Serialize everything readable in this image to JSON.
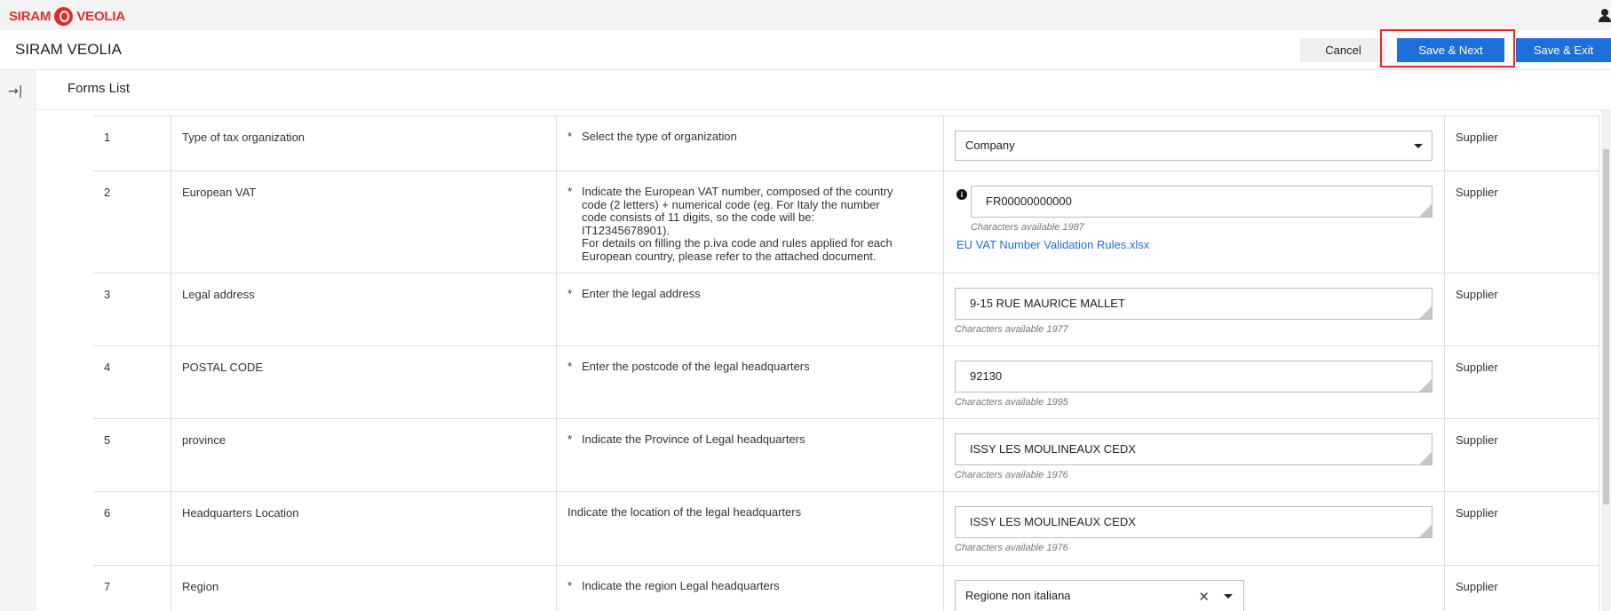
{
  "brand": {
    "left": "SIRAM",
    "right": "VEOLIA"
  },
  "header": {
    "title": "SIRAM VEOLIA",
    "cancel_label": "Cancel",
    "save_next_label": "Save & Next",
    "save_exit_label": "Save & Exit"
  },
  "subheader": {
    "title": "Forms List"
  },
  "rows": [
    {
      "num": "1",
      "label": "Type of tax organization",
      "required": "*",
      "instruction": "Select the type of organization",
      "value": "Company",
      "owner": "Supplier"
    },
    {
      "num": "2",
      "label": "European VAT",
      "required": "*",
      "instruction_lines": [
        "Indicate the European VAT number, composed of the country",
        "code (2 letters) + numerical code (eg. For Italy the number",
        "code consists of 11 digits, so the code will be:",
        "IT12345678901).",
        "For details on filling the p.iva code and rules applied for each",
        "European country, please refer to the attached document."
      ],
      "value": "FR00000000000",
      "chars": "Characters available 1987",
      "link": "EU VAT Number Validation Rules.xlsx",
      "owner": "Supplier"
    },
    {
      "num": "3",
      "label": "Legal address",
      "required": "*",
      "instruction": "Enter the legal address",
      "value": "9-15 RUE MAURICE MALLET",
      "chars": "Characters available 1977",
      "owner": "Supplier"
    },
    {
      "num": "4",
      "label": "POSTAL CODE",
      "required": "*",
      "instruction": "Enter the postcode of the legal headquarters",
      "value": "92130",
      "chars": "Characters available 1995",
      "owner": "Supplier"
    },
    {
      "num": "5",
      "label": "province",
      "required": "*",
      "instruction": "Indicate the Province of Legal headquarters",
      "value": "ISSY LES MOULINEAUX CEDX",
      "chars": "Characters available 1976",
      "owner": "Supplier"
    },
    {
      "num": "6",
      "label": "Headquarters Location",
      "required": "",
      "instruction": "Indicate the location of the legal headquarters",
      "value": "ISSY LES MOULINEAUX CEDX",
      "chars": "Characters available 1976",
      "owner": "Supplier"
    },
    {
      "num": "7",
      "label": "Region",
      "required": "*",
      "instruction": "Indicate the region Legal headquarters",
      "value": "Regione non italiana",
      "owner": "Supplier"
    }
  ],
  "colors": {
    "accent": "#1f6fdb",
    "highlight": "#e22222",
    "brand": "#e52a25"
  },
  "icons": {
    "collapse": "collapse-sidebar-icon",
    "user": "user-icon",
    "info": "info-icon",
    "clear": "clear-icon",
    "caret": "chevron-down-icon"
  }
}
